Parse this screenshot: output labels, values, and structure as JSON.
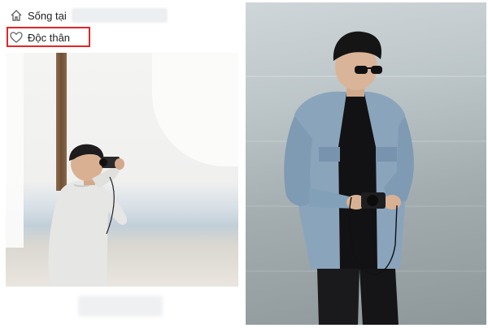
{
  "profile": {
    "lives_in_label": "Sống tại",
    "relationship_label": "Độc thân"
  },
  "icons": {
    "home": "home-icon",
    "heart": "heart-icon"
  },
  "colors": {
    "highlight": "#e0262a",
    "text": "#1c1e21"
  }
}
